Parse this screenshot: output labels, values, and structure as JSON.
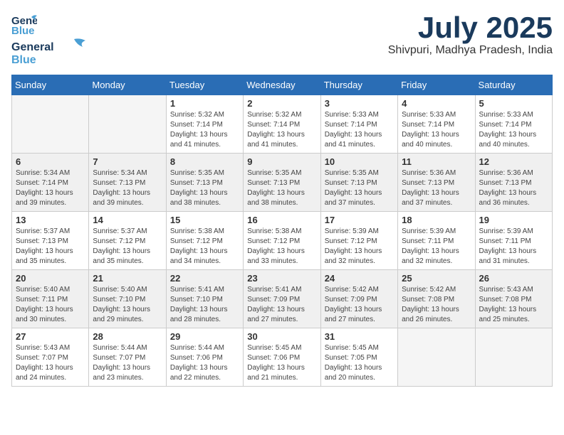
{
  "logo": {
    "line1": "General",
    "line2": "Blue"
  },
  "header": {
    "month": "July 2025",
    "location": "Shivpuri, Madhya Pradesh, India"
  },
  "weekdays": [
    "Sunday",
    "Monday",
    "Tuesday",
    "Wednesday",
    "Thursday",
    "Friday",
    "Saturday"
  ],
  "weeks": [
    [
      {
        "day": "",
        "info": ""
      },
      {
        "day": "",
        "info": ""
      },
      {
        "day": "1",
        "info": "Sunrise: 5:32 AM\nSunset: 7:14 PM\nDaylight: 13 hours and 41 minutes."
      },
      {
        "day": "2",
        "info": "Sunrise: 5:32 AM\nSunset: 7:14 PM\nDaylight: 13 hours and 41 minutes."
      },
      {
        "day": "3",
        "info": "Sunrise: 5:33 AM\nSunset: 7:14 PM\nDaylight: 13 hours and 41 minutes."
      },
      {
        "day": "4",
        "info": "Sunrise: 5:33 AM\nSunset: 7:14 PM\nDaylight: 13 hours and 40 minutes."
      },
      {
        "day": "5",
        "info": "Sunrise: 5:33 AM\nSunset: 7:14 PM\nDaylight: 13 hours and 40 minutes."
      }
    ],
    [
      {
        "day": "6",
        "info": "Sunrise: 5:34 AM\nSunset: 7:14 PM\nDaylight: 13 hours and 39 minutes."
      },
      {
        "day": "7",
        "info": "Sunrise: 5:34 AM\nSunset: 7:13 PM\nDaylight: 13 hours and 39 minutes."
      },
      {
        "day": "8",
        "info": "Sunrise: 5:35 AM\nSunset: 7:13 PM\nDaylight: 13 hours and 38 minutes."
      },
      {
        "day": "9",
        "info": "Sunrise: 5:35 AM\nSunset: 7:13 PM\nDaylight: 13 hours and 38 minutes."
      },
      {
        "day": "10",
        "info": "Sunrise: 5:35 AM\nSunset: 7:13 PM\nDaylight: 13 hours and 37 minutes."
      },
      {
        "day": "11",
        "info": "Sunrise: 5:36 AM\nSunset: 7:13 PM\nDaylight: 13 hours and 37 minutes."
      },
      {
        "day": "12",
        "info": "Sunrise: 5:36 AM\nSunset: 7:13 PM\nDaylight: 13 hours and 36 minutes."
      }
    ],
    [
      {
        "day": "13",
        "info": "Sunrise: 5:37 AM\nSunset: 7:13 PM\nDaylight: 13 hours and 35 minutes."
      },
      {
        "day": "14",
        "info": "Sunrise: 5:37 AM\nSunset: 7:12 PM\nDaylight: 13 hours and 35 minutes."
      },
      {
        "day": "15",
        "info": "Sunrise: 5:38 AM\nSunset: 7:12 PM\nDaylight: 13 hours and 34 minutes."
      },
      {
        "day": "16",
        "info": "Sunrise: 5:38 AM\nSunset: 7:12 PM\nDaylight: 13 hours and 33 minutes."
      },
      {
        "day": "17",
        "info": "Sunrise: 5:39 AM\nSunset: 7:12 PM\nDaylight: 13 hours and 32 minutes."
      },
      {
        "day": "18",
        "info": "Sunrise: 5:39 AM\nSunset: 7:11 PM\nDaylight: 13 hours and 32 minutes."
      },
      {
        "day": "19",
        "info": "Sunrise: 5:39 AM\nSunset: 7:11 PM\nDaylight: 13 hours and 31 minutes."
      }
    ],
    [
      {
        "day": "20",
        "info": "Sunrise: 5:40 AM\nSunset: 7:11 PM\nDaylight: 13 hours and 30 minutes."
      },
      {
        "day": "21",
        "info": "Sunrise: 5:40 AM\nSunset: 7:10 PM\nDaylight: 13 hours and 29 minutes."
      },
      {
        "day": "22",
        "info": "Sunrise: 5:41 AM\nSunset: 7:10 PM\nDaylight: 13 hours and 28 minutes."
      },
      {
        "day": "23",
        "info": "Sunrise: 5:41 AM\nSunset: 7:09 PM\nDaylight: 13 hours and 27 minutes."
      },
      {
        "day": "24",
        "info": "Sunrise: 5:42 AM\nSunset: 7:09 PM\nDaylight: 13 hours and 27 minutes."
      },
      {
        "day": "25",
        "info": "Sunrise: 5:42 AM\nSunset: 7:08 PM\nDaylight: 13 hours and 26 minutes."
      },
      {
        "day": "26",
        "info": "Sunrise: 5:43 AM\nSunset: 7:08 PM\nDaylight: 13 hours and 25 minutes."
      }
    ],
    [
      {
        "day": "27",
        "info": "Sunrise: 5:43 AM\nSunset: 7:07 PM\nDaylight: 13 hours and 24 minutes."
      },
      {
        "day": "28",
        "info": "Sunrise: 5:44 AM\nSunset: 7:07 PM\nDaylight: 13 hours and 23 minutes."
      },
      {
        "day": "29",
        "info": "Sunrise: 5:44 AM\nSunset: 7:06 PM\nDaylight: 13 hours and 22 minutes."
      },
      {
        "day": "30",
        "info": "Sunrise: 5:45 AM\nSunset: 7:06 PM\nDaylight: 13 hours and 21 minutes."
      },
      {
        "day": "31",
        "info": "Sunrise: 5:45 AM\nSunset: 7:05 PM\nDaylight: 13 hours and 20 minutes."
      },
      {
        "day": "",
        "info": ""
      },
      {
        "day": "",
        "info": ""
      }
    ]
  ]
}
